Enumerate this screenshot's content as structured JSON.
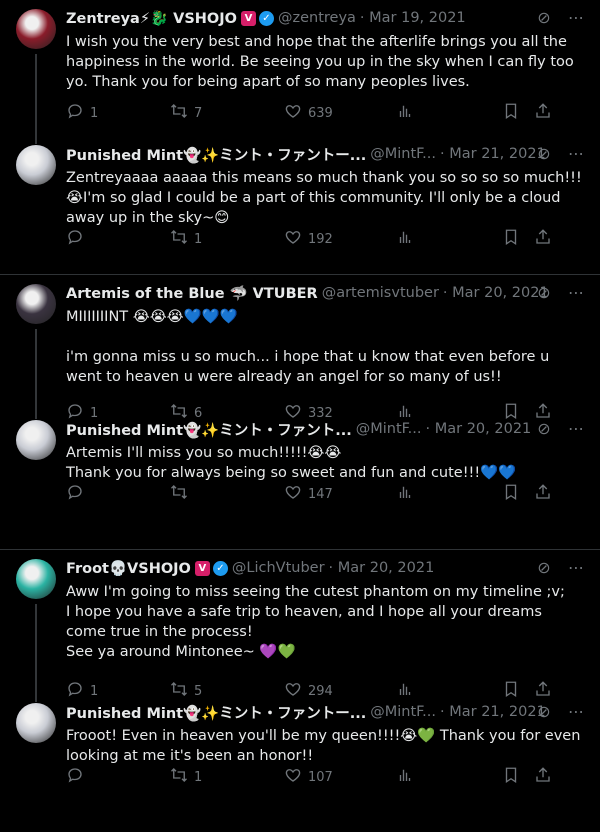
{
  "threads": [
    {
      "tweets": [
        {
          "name": "Zentreya⚡🐉 VSHOJO",
          "verified": true,
          "vbadge": "V",
          "handle": "@zentreya",
          "date": "· Mar 19, 2021",
          "text": "I wish you the very best and hope that the afterlife brings you all the happiness in the world. Be seeing you up in the sky when I can fly too yo. Thank you for being apart of so many peoples lives.",
          "replies": "1",
          "retweets": "7",
          "likes": "639",
          "views": "",
          "avatar_color": "#8a1c2a"
        },
        {
          "name": "Punished Mint👻✨ミント・ファントー...",
          "verified": false,
          "handle": "@MintF...",
          "date": "· Mar 21, 2021",
          "text": "Zentreyaaaa aaaaa this means so much thank you so so so so much!!!😭I'm so glad I could be a part of this community. I'll only be a cloud away up in the sky~😊",
          "replies": "",
          "retweets": "1",
          "likes": "192",
          "views": "",
          "avatar_color": "#c9ccd4"
        }
      ]
    },
    {
      "tweets": [
        {
          "name": "Artemis of the Blue 🦈 VTUBER",
          "verified": false,
          "handle": "@artemisvtuber",
          "date": "· Mar 20, 2021",
          "text": "MIIIIIIINT 😭😭😭💙💙💙\n\ni'm gonna miss u so much... i hope that u know that even before u went to heaven u were already an angel for so many of us!!",
          "replies": "1",
          "retweets": "6",
          "likes": "332",
          "views": "",
          "avatar_color": "#3a3340"
        },
        {
          "name": "Punished Mint👻✨ミント・ファント...",
          "verified": false,
          "handle": "@MintF...",
          "date": "· Mar 20, 2021",
          "text": "Artemis I'll miss you so much!!!!!😭😭\nThank you for always being so sweet and fun and cute!!!💙💙",
          "replies": "",
          "retweets": "",
          "likes": "147",
          "views": "",
          "avatar_color": "#c9ccd4"
        }
      ]
    },
    {
      "tweets": [
        {
          "name": "Froot💀VSHOJO",
          "verified": true,
          "vbadge": "V",
          "handle": "@LichVtuber",
          "date": "· Mar 20, 2021",
          "text": "Aww I'm going to miss seeing the cutest phantom on my timeline ;v;\nI hope you have a safe trip to heaven, and I hope all your dreams come true in the process!\nSee ya around Mintonee~ 💜💚",
          "replies": "1",
          "retweets": "5",
          "likes": "294",
          "views": "",
          "avatar_color": "#2bb3a3"
        },
        {
          "name": "Punished Mint👻✨ミント・ファントー...",
          "verified": false,
          "handle": "@MintF...",
          "date": "· Mar 21, 2021",
          "text": "Frooot! Even in heaven you'll be my queen!!!!😭💚 Thank you for even looking at me it's been an honor!!",
          "replies": "",
          "retweets": "1",
          "likes": "107",
          "views": "",
          "avatar_color": "#c9ccd4"
        }
      ]
    }
  ],
  "colors": {
    "background": "#000000",
    "text": "#e7e9ea",
    "muted": "#71767b",
    "verified": "#1d9bf0",
    "vshojo": "#d61f69",
    "divider": "#2f3336"
  }
}
